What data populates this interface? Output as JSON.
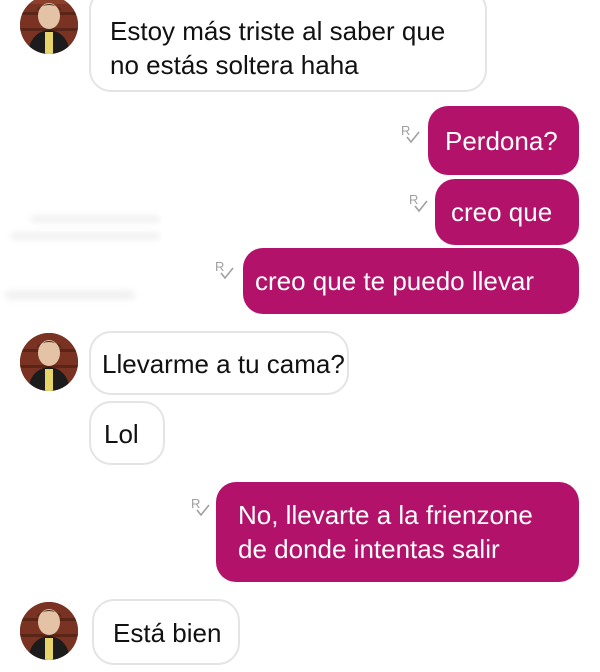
{
  "conversation": {
    "messages": [
      {
        "sender": "them",
        "text": "Estoy más triste al saber que\nno estás soltera haha"
      },
      {
        "sender": "me",
        "text": "Perdona?"
      },
      {
        "sender": "me",
        "text": "creo que"
      },
      {
        "sender": "me",
        "text": "creo que te puedo llevar"
      },
      {
        "sender": "them",
        "text": "Llevarme a tu cama?"
      },
      {
        "sender": "them",
        "text": "Lol"
      },
      {
        "sender": "me",
        "text": "No, llevarte a la frienzone\nde donde intentas salir"
      },
      {
        "sender": "them",
        "text": "Está bien"
      }
    ]
  },
  "colors": {
    "outgoing_bubble": "#b3126b",
    "incoming_border": "#e4e4e4",
    "receipt_icon": "#a0a0a0"
  },
  "icons": {
    "avatar": "contact-avatar",
    "receipt": "read-receipt-icon"
  }
}
